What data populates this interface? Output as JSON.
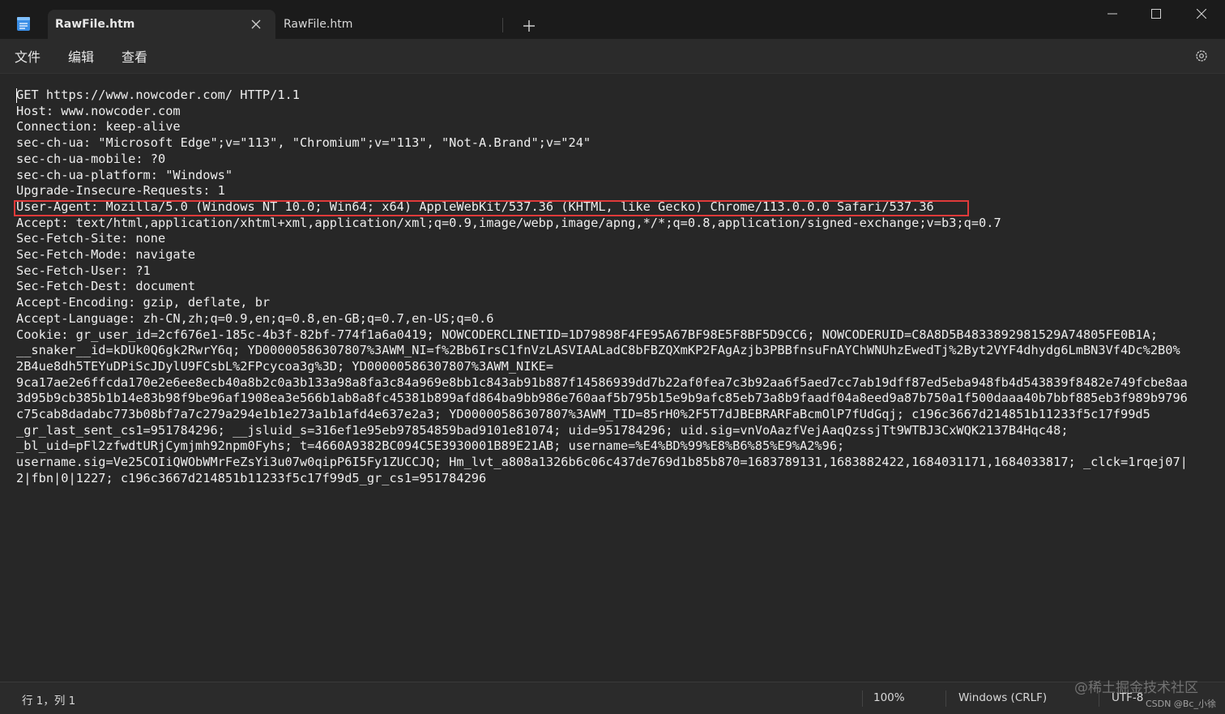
{
  "tabs": [
    {
      "label": "RawFile.htm",
      "active": true
    },
    {
      "label": "RawFile.htm",
      "active": false
    }
  ],
  "menu": {
    "file": "文件",
    "edit": "编辑",
    "view": "查看"
  },
  "icons": {
    "app": "notepad-icon",
    "close_tab": "close-icon",
    "new_tab": "plus-icon",
    "minimize": "minimize-icon",
    "maximize": "maximize-icon",
    "close_window": "close-icon",
    "settings": "gear-icon"
  },
  "colors": {
    "highlight_box": "#e03a3a",
    "editor_bg": "#272727",
    "titlebar_bg": "#1b1b1b"
  },
  "editor": {
    "highlighted_line_index": 7,
    "lines": [
      "GET https://www.nowcoder.com/ HTTP/1.1",
      "Host: www.nowcoder.com",
      "Connection: keep-alive",
      "sec-ch-ua: \"Microsoft Edge\";v=\"113\", \"Chromium\";v=\"113\", \"Not-A.Brand\";v=\"24\"",
      "sec-ch-ua-mobile: ?0",
      "sec-ch-ua-platform: \"Windows\"",
      "Upgrade-Insecure-Requests: 1",
      "User-Agent: Mozilla/5.0 (Windows NT 10.0; Win64; x64) AppleWebKit/537.36 (KHTML, like Gecko) Chrome/113.0.0.0 Safari/537.36",
      "Accept: text/html,application/xhtml+xml,application/xml;q=0.9,image/webp,image/apng,*/*;q=0.8,application/signed-exchange;v=b3;q=0.7",
      "Sec-Fetch-Site: none",
      "Sec-Fetch-Mode: navigate",
      "Sec-Fetch-User: ?1",
      "Sec-Fetch-Dest: document",
      "Accept-Encoding: gzip, deflate, br",
      "Accept-Language: zh-CN,zh;q=0.9,en;q=0.8,en-GB;q=0.7,en-US;q=0.6",
      "Cookie: gr_user_id=2cf676e1-185c-4b3f-82bf-774f1a6a0419; NOWCODERCLINETID=1D79898F4FE95A67BF98E5F8BF5D9CC6; NOWCODERUID=C8A8D5B4833892981529A74805FE0B1A;",
      "__snaker__id=kDUk0Q6gk2RwrY6q; YD00000586307807%3AWM_NI=f%2Bb6IrsC1fnVzLASVIAALadC8bFBZQXmKP2FAgAzjb3PBBfnsuFnAYChWNUhzEwedTj%2Byt2VYF4dhydg6LmBN3Vf4Dc%2B0%",
      "2B4ue8dh5TEYuDPiScJDylU9FCsbL%2FPcycoa3g%3D; YD00000586307807%3AWM_NIKE=",
      "9ca17ae2e6ffcda170e2e6ee8ecb40a8b2c0a3b133a98a8fa3c84a969e8bb1c843ab91b887f14586939dd7b22af0fea7c3b92aa6f5aed7cc7ab19dff87ed5eba948fb4d543839f8482e749fcbe8aa",
      "3d95b9cb385b1b14e83b98f9be96af1908ea3e566b1ab8a8fc45381b899afd864ba9bb986e760aaf5b795b15e9b9afc85eb73a8b9faadf04a8eed9a87b750a1f500daaa40b7bbf885eb3f989b9796",
      "c75cab8dadabc773b08bf7a7c279a294e1b1e273a1b1afd4e637e2a3; YD00000586307807%3AWM_TID=85rH0%2F5T7dJBEBRARFaBcmOlP7fUdGqj; c196c3667d214851b11233f5c17f99d5",
      "_gr_last_sent_cs1=951784296; __jsluid_s=316ef1e95eb97854859bad9101e81074; uid=951784296; uid.sig=vnVoAazfVejAaqQzssjTt9WTBJ3CxWQK2137B4Hqc48;",
      "_bl_uid=pFl2zfwdtURjCymjmh92npm0Fyhs; t=4660A9382BC094C5E3930001B89E21AB; username=%E4%BD%99%E8%B6%85%E9%A2%96;",
      "username.sig=Ve25COIiQWObWMrFeZsYi3u07w0qipP6I5Fy1ZUCCJQ; Hm_lvt_a808a1326b6c06c437de769d1b85b870=1683789131,1683882422,1684031171,1684033817; _clck=1rqej07|",
      "2|fbn|0|1227; c196c3667d214851b11233f5c17f99d5_gr_cs1=951784296"
    ]
  },
  "status": {
    "position": "行 1，列 1",
    "zoom": "100%",
    "line_ending": "Windows (CRLF)",
    "encoding": "UTF-8"
  },
  "watermark": {
    "main": "@稀土掘金技术社区",
    "sub": "CSDN @Bc_小徐"
  }
}
